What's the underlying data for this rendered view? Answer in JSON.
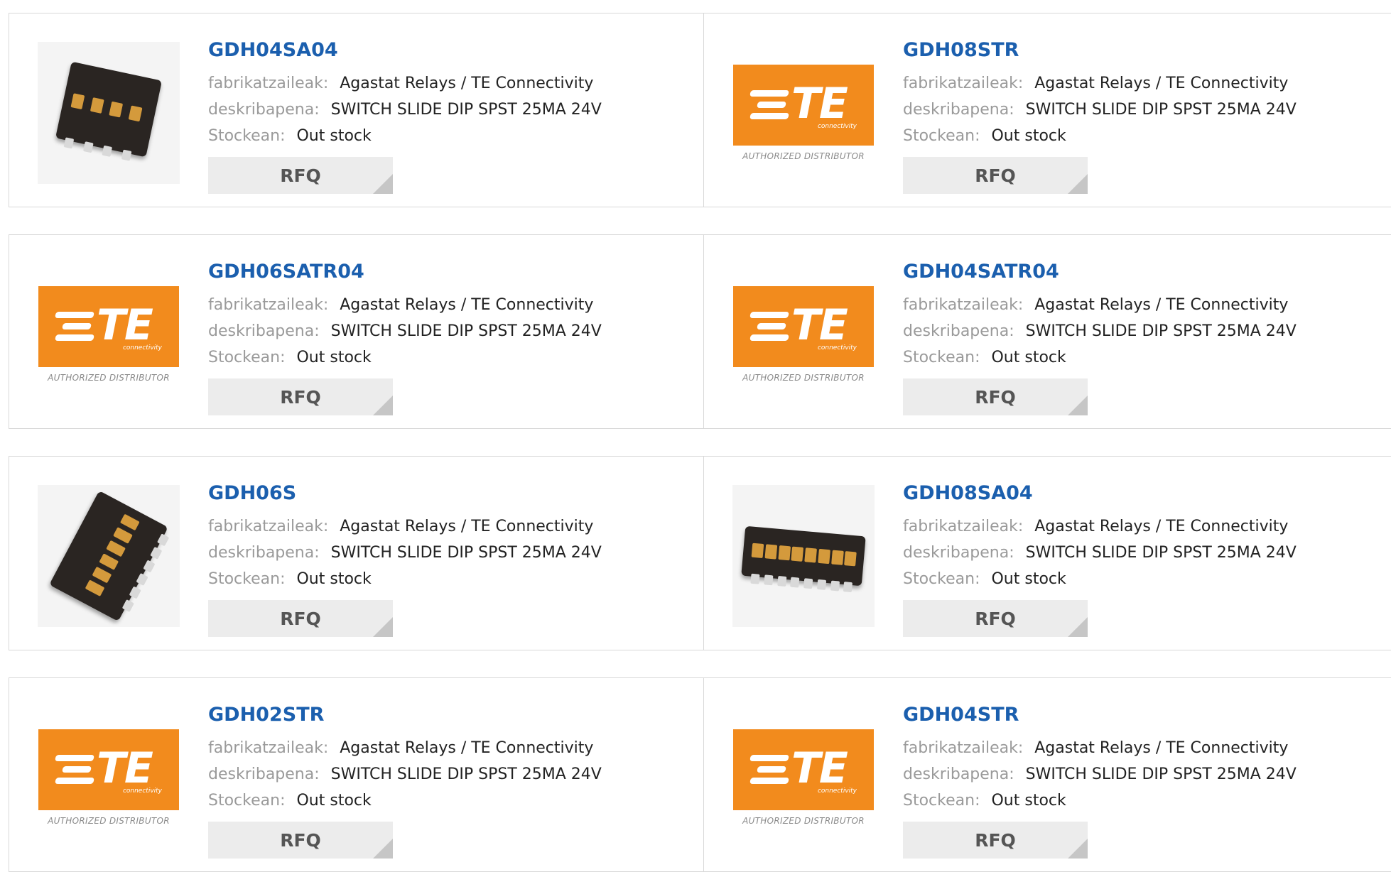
{
  "labels": {
    "manufacturer": "fabrikatzaileak:",
    "description": "deskribapena:",
    "stock": "Stockean:",
    "rfq": "RFQ"
  },
  "te_logo": {
    "mark": "TE",
    "subtext": "connectivity",
    "authorized": "AUTHORIZED DISTRIBUTOR"
  },
  "products": [
    {
      "part": "GDH04SA04",
      "manufacturer": "Agastat Relays / TE Connectivity",
      "description": "SWITCH SLIDE DIP SPST 25MA 24V",
      "stock": "Out stock",
      "image": "dip-switch-4"
    },
    {
      "part": "GDH08STR",
      "manufacturer": "Agastat Relays / TE Connectivity",
      "description": "SWITCH SLIDE DIP SPST 25MA 24V",
      "stock": "Out stock",
      "image": "te-logo"
    },
    {
      "part": "GDH06SATR04",
      "manufacturer": "Agastat Relays / TE Connectivity",
      "description": "SWITCH SLIDE DIP SPST 25MA 24V",
      "stock": "Out stock",
      "image": "te-logo"
    },
    {
      "part": "GDH04SATR04",
      "manufacturer": "Agastat Relays / TE Connectivity",
      "description": "SWITCH SLIDE DIP SPST 25MA 24V",
      "stock": "Out stock",
      "image": "te-logo"
    },
    {
      "part": "GDH06S",
      "manufacturer": "Agastat Relays / TE Connectivity",
      "description": "SWITCH SLIDE DIP SPST 25MA 24V",
      "stock": "Out stock",
      "image": "dip-switch-6"
    },
    {
      "part": "GDH08SA04",
      "manufacturer": "Agastat Relays / TE Connectivity",
      "description": "SWITCH SLIDE DIP SPST 25MA 24V",
      "stock": "Out stock",
      "image": "dip-switch-8"
    },
    {
      "part": "GDH02STR",
      "manufacturer": "Agastat Relays / TE Connectivity",
      "description": "SWITCH SLIDE DIP SPST 25MA 24V",
      "stock": "Out stock",
      "image": "te-logo"
    },
    {
      "part": "GDH04STR",
      "manufacturer": "Agastat Relays / TE Connectivity",
      "description": "SWITCH SLIDE DIP SPST 25MA 24V",
      "stock": "Out stock",
      "image": "te-logo"
    }
  ]
}
